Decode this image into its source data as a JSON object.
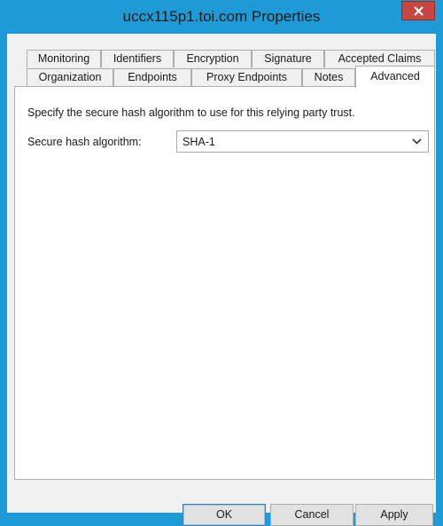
{
  "window": {
    "title": "uccx115p1.toi.com Properties"
  },
  "tabs": {
    "back_row": [
      "Monitoring",
      "Identifiers",
      "Encryption",
      "Signature",
      "Accepted Claims"
    ],
    "front_row": [
      "Organization",
      "Endpoints",
      "Proxy Endpoints",
      "Notes",
      "Advanced"
    ],
    "active": "Advanced"
  },
  "advanced": {
    "description": "Specify the secure hash algorithm to use for this relying party trust.",
    "hash_label": "Secure hash algorithm:",
    "hash_value": "SHA-1"
  },
  "buttons": {
    "ok": "OK",
    "cancel": "Cancel",
    "apply": "Apply"
  },
  "icons": {
    "close": "close-icon",
    "dropdown": "chevron-down-icon"
  },
  "colors": {
    "titlebar": "#1e9bd7",
    "close_button": "#c7463f",
    "client": "#f0f0f0"
  }
}
